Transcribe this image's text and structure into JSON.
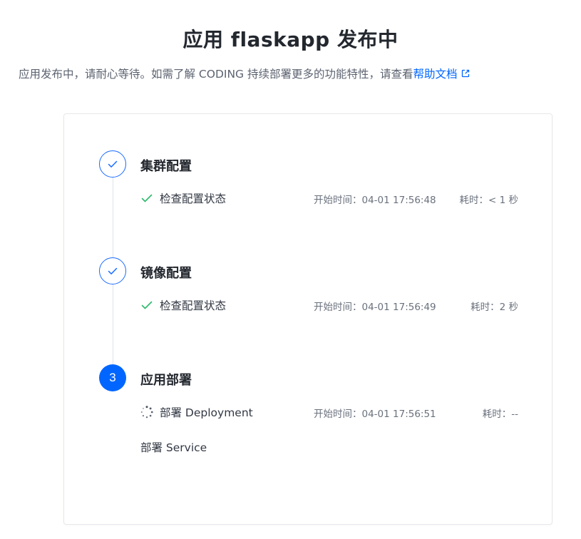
{
  "header": {
    "title": "应用 flaskapp 发布中",
    "subtitle_text": "应用发布中，请耐心等待。如需了解 CODING 持续部署更多的功能特性，请查看",
    "help_link": "帮助文档"
  },
  "steps": [
    {
      "title": "集群配置",
      "status": "done",
      "tasks": [
        {
          "status": "success",
          "name": "检查配置状态",
          "start": "开始时间：04-01 17:56:48",
          "duration": "耗时：< 1 秒"
        }
      ]
    },
    {
      "title": "镜像配置",
      "status": "done",
      "tasks": [
        {
          "status": "success",
          "name": "检查配置状态",
          "start": "开始时间：04-01 17:56:49",
          "duration": "耗时：2 秒"
        }
      ]
    },
    {
      "number": "3",
      "title": "应用部署",
      "status": "active",
      "tasks": [
        {
          "status": "running",
          "name": "部署 Deployment",
          "start": "开始时间：04-01 17:56:51",
          "duration": "耗时：--"
        },
        {
          "status": "pending",
          "name": "部署 Service"
        }
      ]
    }
  ],
  "colors": {
    "accent": "#0066ff",
    "success": "#2fb86e",
    "muted": "#6a717d"
  },
  "icons": {
    "done_step": "check-icon",
    "success_task": "check-icon",
    "running_task": "spinner-icon",
    "external_link": "external-link-icon"
  }
}
